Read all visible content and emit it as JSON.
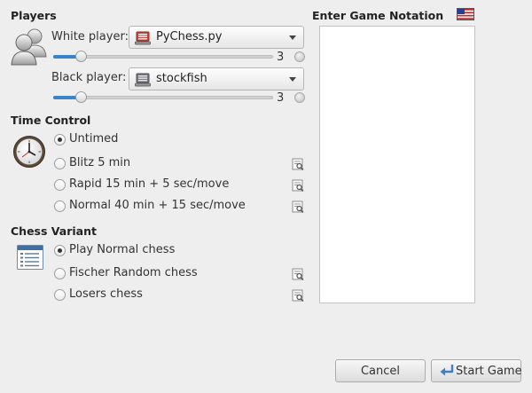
{
  "players": {
    "title": "Players",
    "white_label": "White player:",
    "white_value": "PyChess.py",
    "white_level": 3,
    "black_label": "Black player:",
    "black_value": "stockfish",
    "black_level": 3,
    "level_max": 20
  },
  "time_control": {
    "title": "Time Control",
    "options": [
      {
        "label": "Untimed",
        "checked": true
      },
      {
        "label": "Blitz 5 min",
        "checked": false
      },
      {
        "label": "Rapid 15 min + 5 sec/move",
        "checked": false
      },
      {
        "label": "Normal 40 min + 15 sec/move",
        "checked": false
      }
    ]
  },
  "variant": {
    "title": "Chess Variant",
    "options": [
      {
        "label": "Play Normal chess",
        "checked": true
      },
      {
        "label": "Fischer Random chess",
        "checked": false
      },
      {
        "label": "Losers chess",
        "checked": false
      }
    ]
  },
  "notation": {
    "title": "Enter Game Notation"
  },
  "buttons": {
    "cancel": "Cancel",
    "start": "Start Game"
  },
  "colors": {
    "accent": "#3c83c9",
    "white_player_icon": "#c8463d",
    "black_player_icon": "#7a7a84"
  },
  "icons": {
    "players": "people-icon",
    "clock": "clock-icon",
    "variant": "board-list-icon",
    "flag": "us-flag-icon",
    "start": "enter-arrow-icon"
  }
}
